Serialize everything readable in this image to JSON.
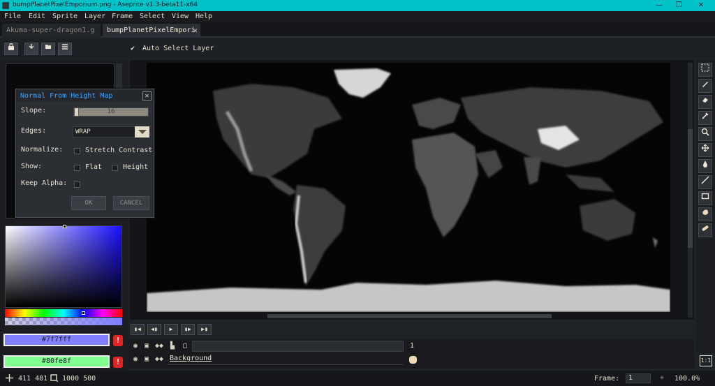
{
  "window": {
    "title": "bumpPlanetPixelEmporium.png - Aseprite v1.3-beta11-x64",
    "minimize": "—",
    "maximize": "❐",
    "close": "✕"
  },
  "menu": [
    "File",
    "Edit",
    "Sprite",
    "Layer",
    "Frame",
    "Select",
    "View",
    "Help"
  ],
  "tabs": [
    {
      "label": "Akuma-super-dragon1.g",
      "active": false
    },
    {
      "label": "bumpPlanetPixelEmpori",
      "active": true,
      "close": "✕"
    }
  ],
  "context_bar": {
    "check_glyph": "✔",
    "auto_select_label": "Auto Select Layer"
  },
  "dialog": {
    "title": "Normal From Height Map",
    "close": "✕",
    "slope_label": "Slope:",
    "slope_value": "16",
    "edges_label": "Edges:",
    "edges_value": "WRAP",
    "normalize_label": "Normalize:",
    "stretch_contrast_label": "Stretch Contrast",
    "show_label": "Show:",
    "flat_label": "Flat",
    "height_label": "Height",
    "keep_alpha_label": "Keep Alpha:",
    "ok_label": "OK",
    "cancel_label": "CANCEL"
  },
  "colors": {
    "foreground_hex": "#7f7fff",
    "background_hex": "#80fe8f",
    "warn_glyph": "!"
  },
  "timeline": {
    "frame_number": "1",
    "layer_name": "Background"
  },
  "status": {
    "cursor_pos": "411 481",
    "sprite_size": "1000 500",
    "frame_label": "Frame:",
    "frame_value": "1",
    "plus": "+",
    "zoom": "100.0%",
    "ratio": "1:1"
  }
}
